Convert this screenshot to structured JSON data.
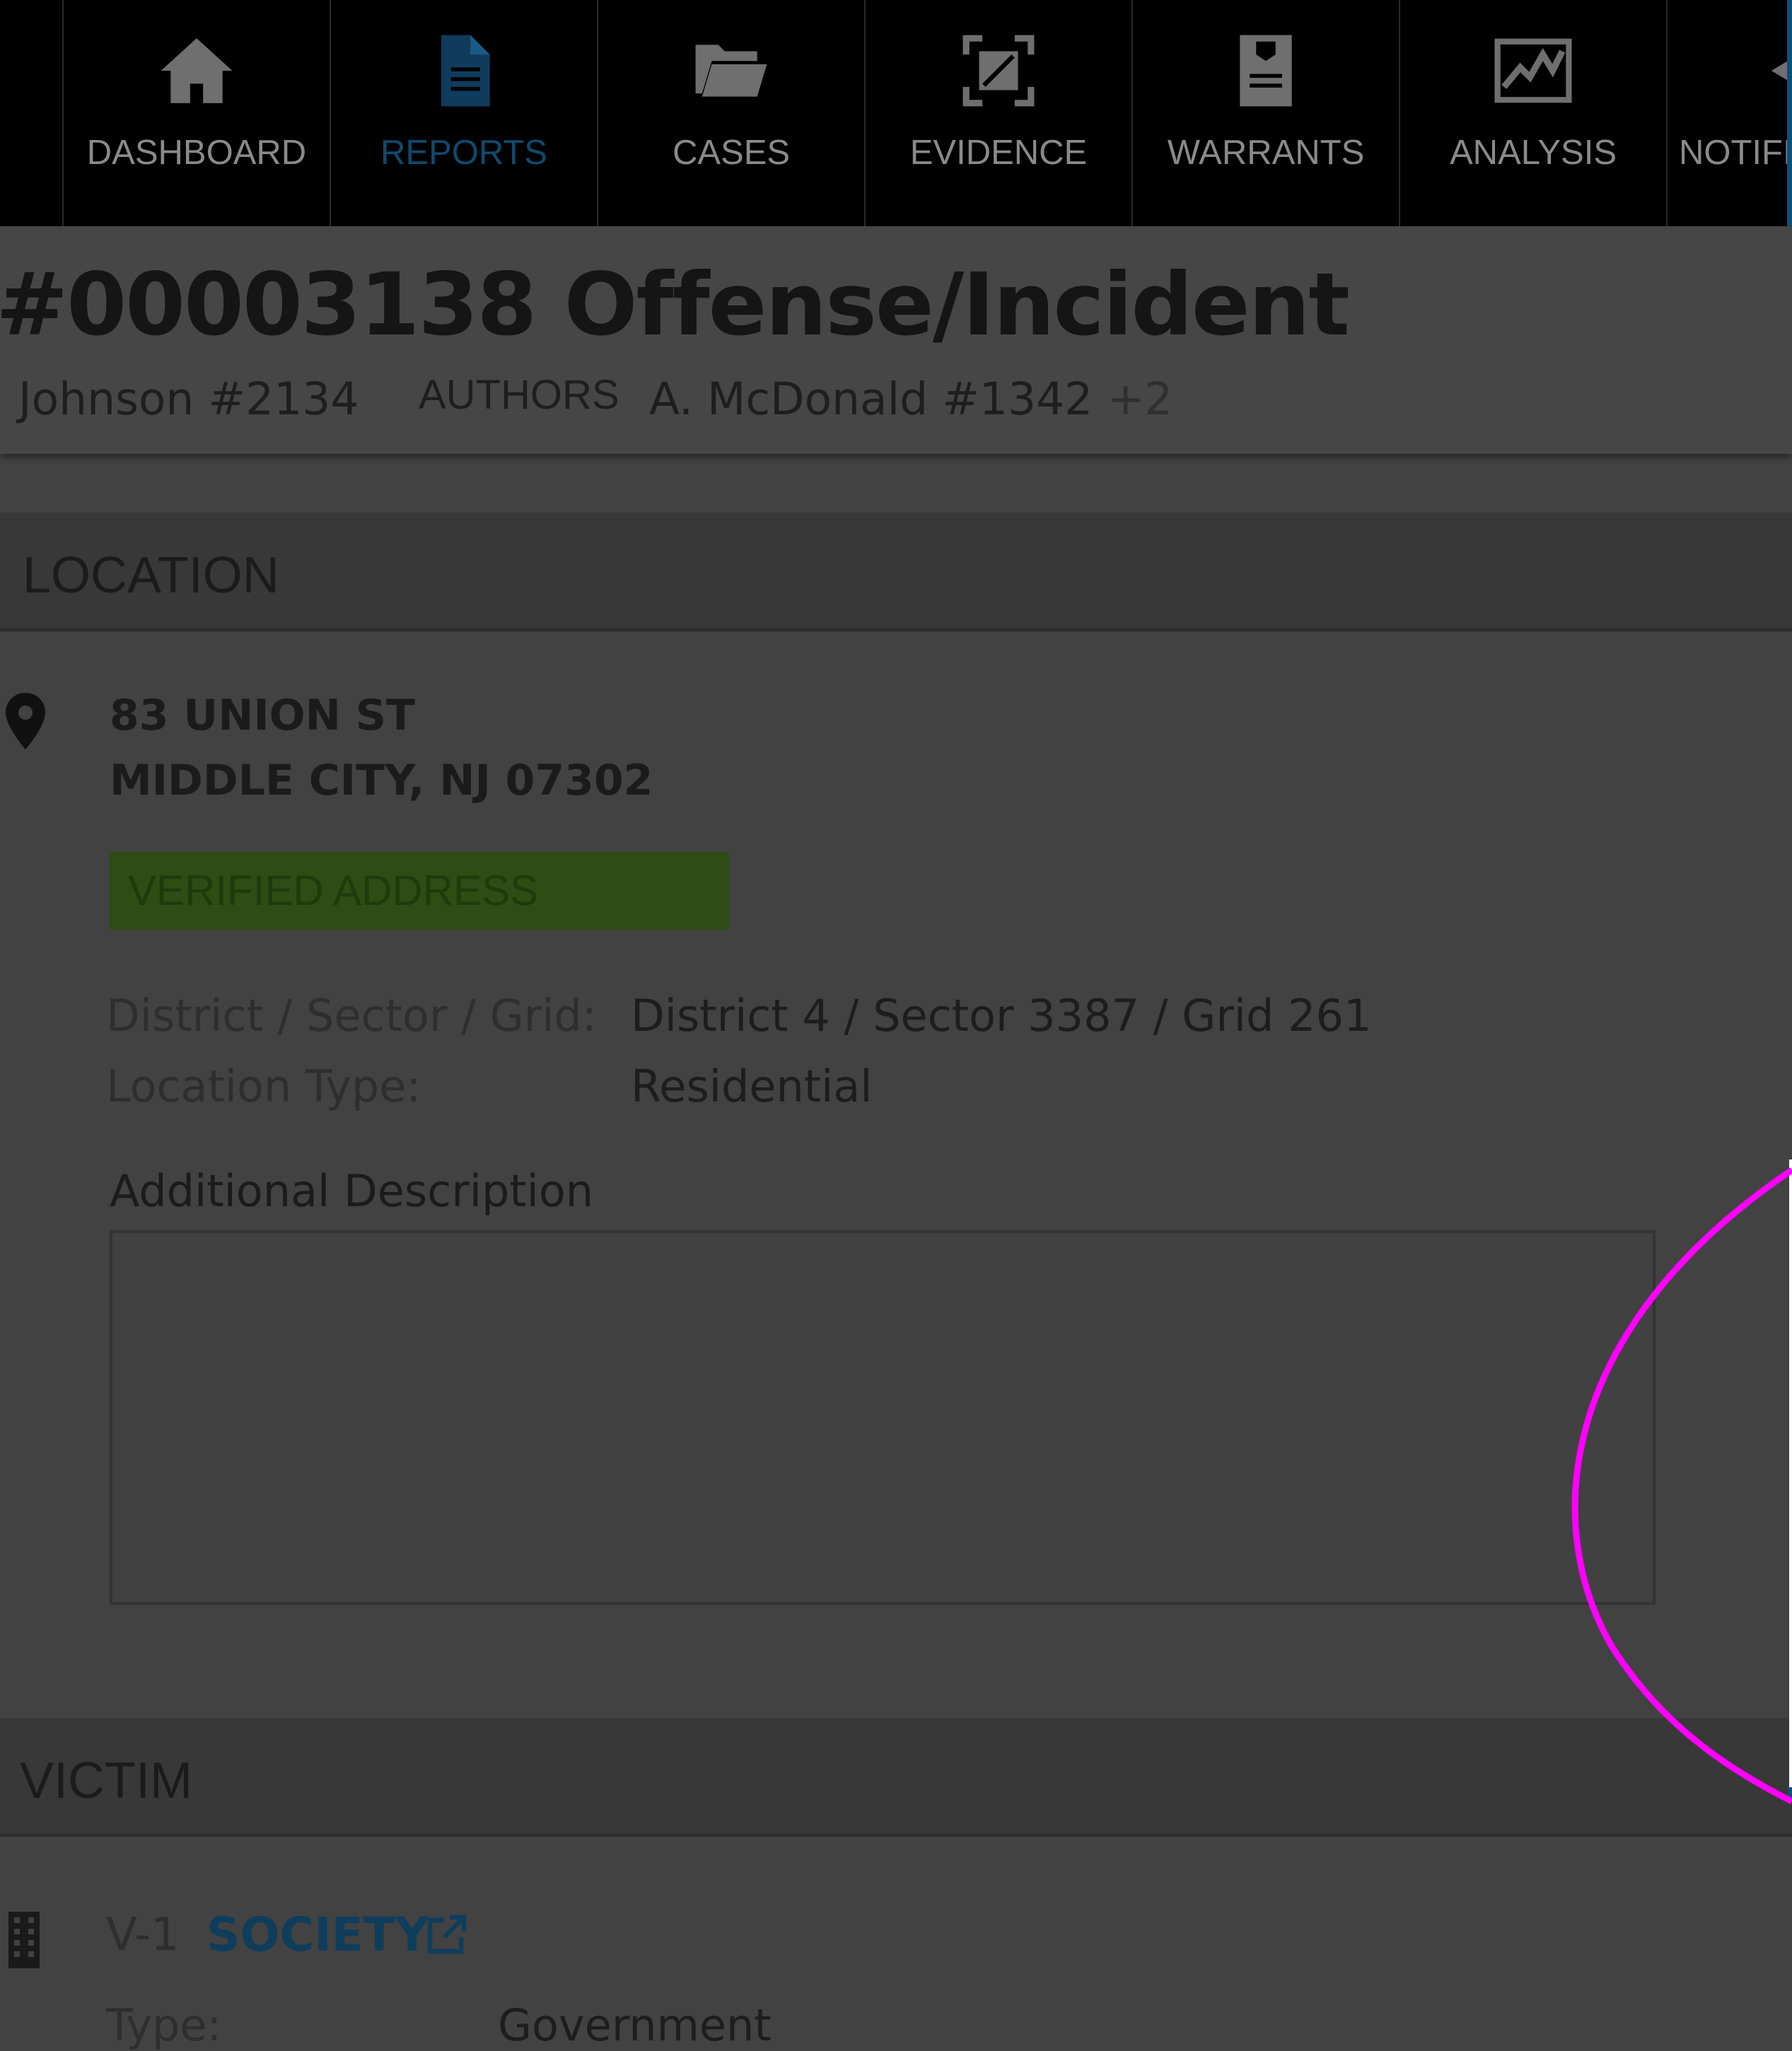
{
  "nav": {
    "items": [
      {
        "label": "DASHBOARD",
        "icon": "home-icon"
      },
      {
        "label": "REPORTS",
        "icon": "document-icon",
        "active": true
      },
      {
        "label": "CASES",
        "icon": "folder-open-icon"
      },
      {
        "label": "EVIDENCE",
        "icon": "evidence-frame-icon"
      },
      {
        "label": "WARRANTS",
        "icon": "warrant-badge-icon"
      },
      {
        "label": "ANALYSIS",
        "icon": "line-chart-icon"
      },
      {
        "label": "NOTIFI",
        "icon": "notification-icon"
      }
    ],
    "active_color": "#0f4a6e"
  },
  "header": {
    "title": "#00003138 Offense/Incident",
    "reporter": ". Johnson #2134",
    "authors_label": "AUTHORS",
    "authors_value": "A. McDonald #1342",
    "authors_more": "+2"
  },
  "location": {
    "section_title": "LOCATION",
    "address_line1": "83 UNION ST",
    "address_line2": "MIDDLE CITY, NJ 07302",
    "verified_badge": "VERIFIED ADDRESS",
    "district_label": "District / Sector / Grid:",
    "district_value": "District 4 / Sector 3387 / Grid 261",
    "location_type_label": "Location Type:",
    "location_type_value": "Residential",
    "additional_description_label": "Additional Description",
    "additional_description_value": ""
  },
  "victim": {
    "section_title": "VICTIM",
    "id": "V-1",
    "name": "SOCIETY",
    "type_label": "Type:",
    "type_value": "Government"
  },
  "colors": {
    "background": "#424242",
    "nav_background": "#000000",
    "verified_badge": "#2d4d14",
    "link": "#0f3d5c",
    "annotation": "#ff00ff"
  }
}
